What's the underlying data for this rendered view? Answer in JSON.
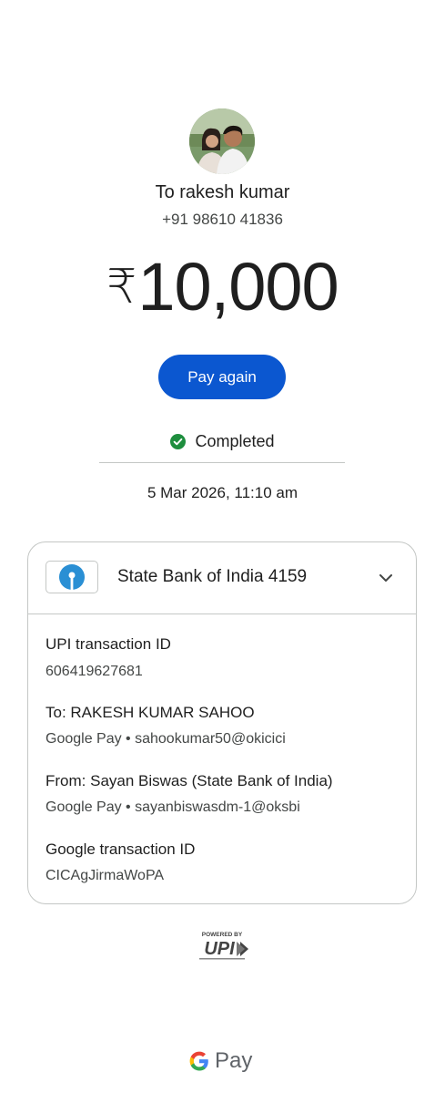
{
  "recipient": {
    "title": "To rakesh kumar",
    "phone": "+91 98610 41836"
  },
  "payment": {
    "currency_symbol": "₹",
    "amount": "10,000"
  },
  "actions": {
    "pay_again_label": "Pay again"
  },
  "status": {
    "label": "Completed",
    "icon": "check-circle-icon",
    "color": "#1e8e3e"
  },
  "datetime": "5 Mar 2026, 11:10 am",
  "bank_account": {
    "name": "State Bank of India 4159",
    "logo": "sbi-logo",
    "expand_icon": "chevron-down-icon"
  },
  "details": {
    "upi_txn_label": "UPI transaction ID",
    "upi_txn_value": "606419627681",
    "to_label": "To: RAKESH KUMAR SAHOO",
    "to_value": "Google Pay • sahookumar50@okicici",
    "from_label": "From: Sayan  Biswas (State Bank of India)",
    "from_value": "Google Pay • sayanbiswasdm-1@oksbi",
    "google_txn_label": "Google transaction ID",
    "google_txn_value": "CICAgJirmaWoPA"
  },
  "footer": {
    "upi_powered": "POWERED BY",
    "upi_brand": "UPI",
    "gpay_text": "Pay"
  },
  "colors": {
    "accent": "#0b57d0",
    "success": "#1e8e3e",
    "sbi_blue": "#2a8fd4"
  }
}
